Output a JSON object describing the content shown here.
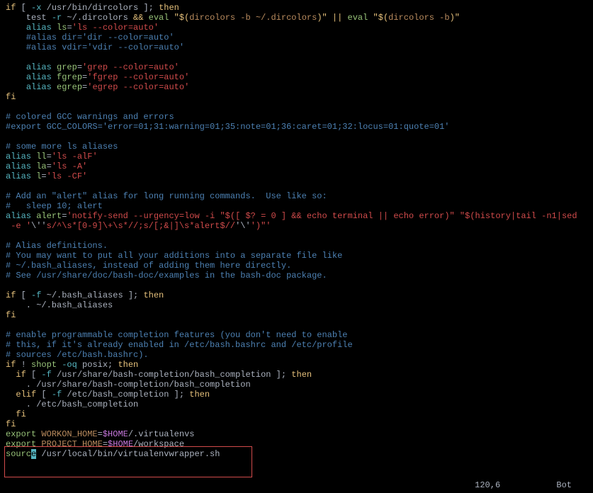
{
  "lines": [
    [
      {
        "t": "if",
        "c": "c-yellow"
      },
      {
        "t": " [ ",
        "c": "c-white"
      },
      {
        "t": "-x",
        "c": "c-cyan"
      },
      {
        "t": " /usr/bin/dircolors ]; ",
        "c": "c-white"
      },
      {
        "t": "then",
        "c": "c-yellow"
      }
    ],
    [
      {
        "t": "    test ",
        "c": "c-white"
      },
      {
        "t": "-r",
        "c": "c-cyan"
      },
      {
        "t": " ~/.dircolors ",
        "c": "c-white"
      },
      {
        "t": "&&",
        "c": "c-yellow"
      },
      {
        "t": " ",
        "c": "c-white"
      },
      {
        "t": "eval",
        "c": "c-green"
      },
      {
        "t": " \"",
        "c": "c-yellow"
      },
      {
        "t": "$(",
        "c": "c-yellow"
      },
      {
        "t": "dircolors -b ~/.dircolors",
        "c": "c-brown"
      },
      {
        "t": ")",
        "c": "c-yellow"
      },
      {
        "t": "\" ",
        "c": "c-yellow"
      },
      {
        "t": "||",
        "c": "c-yellow"
      },
      {
        "t": " ",
        "c": "c-white"
      },
      {
        "t": "eval",
        "c": "c-green"
      },
      {
        "t": " \"",
        "c": "c-yellow"
      },
      {
        "t": "$(",
        "c": "c-yellow"
      },
      {
        "t": "dircolors -b",
        "c": "c-brown"
      },
      {
        "t": ")",
        "c": "c-yellow"
      },
      {
        "t": "\"",
        "c": "c-yellow"
      }
    ],
    [
      {
        "t": "    ",
        "c": "c-white"
      },
      {
        "t": "alias",
        "c": "c-cyan"
      },
      {
        "t": " ",
        "c": "c-white"
      },
      {
        "t": "ls",
        "c": "c-green"
      },
      {
        "t": "=",
        "c": "c-white"
      },
      {
        "t": "'ls --color=auto'",
        "c": "c-red"
      }
    ],
    [
      {
        "t": "    #alias dir='dir --color=auto'",
        "c": "c-blue"
      }
    ],
    [
      {
        "t": "    #alias vdir='vdir --color=auto'",
        "c": "c-blue"
      }
    ],
    [
      {
        "t": "",
        "c": ""
      }
    ],
    [
      {
        "t": "    ",
        "c": "c-white"
      },
      {
        "t": "alias",
        "c": "c-cyan"
      },
      {
        "t": " ",
        "c": "c-white"
      },
      {
        "t": "grep",
        "c": "c-green"
      },
      {
        "t": "=",
        "c": "c-white"
      },
      {
        "t": "'grep --color=auto'",
        "c": "c-red"
      }
    ],
    [
      {
        "t": "    ",
        "c": "c-white"
      },
      {
        "t": "alias",
        "c": "c-cyan"
      },
      {
        "t": " ",
        "c": "c-white"
      },
      {
        "t": "fgrep",
        "c": "c-green"
      },
      {
        "t": "=",
        "c": "c-white"
      },
      {
        "t": "'fgrep --color=auto'",
        "c": "c-red"
      }
    ],
    [
      {
        "t": "    ",
        "c": "c-white"
      },
      {
        "t": "alias",
        "c": "c-cyan"
      },
      {
        "t": " ",
        "c": "c-white"
      },
      {
        "t": "egrep",
        "c": "c-green"
      },
      {
        "t": "=",
        "c": "c-white"
      },
      {
        "t": "'egrep --color=auto'",
        "c": "c-red"
      }
    ],
    [
      {
        "t": "fi",
        "c": "c-yellow"
      }
    ],
    [
      {
        "t": "",
        "c": ""
      }
    ],
    [
      {
        "t": "# colored GCC warnings and errors",
        "c": "c-blue"
      }
    ],
    [
      {
        "t": "#export GCC_COLORS='error=01;31:warning=01;35:note=01;36:caret=01;32:locus=01:quote=01'",
        "c": "c-blue"
      }
    ],
    [
      {
        "t": "",
        "c": ""
      }
    ],
    [
      {
        "t": "# some more ls aliases",
        "c": "c-blue"
      }
    ],
    [
      {
        "t": "alias",
        "c": "c-cyan"
      },
      {
        "t": " ",
        "c": "c-white"
      },
      {
        "t": "ll",
        "c": "c-green"
      },
      {
        "t": "=",
        "c": "c-white"
      },
      {
        "t": "'ls -alF'",
        "c": "c-red"
      }
    ],
    [
      {
        "t": "alias",
        "c": "c-cyan"
      },
      {
        "t": " ",
        "c": "c-white"
      },
      {
        "t": "la",
        "c": "c-green"
      },
      {
        "t": "=",
        "c": "c-white"
      },
      {
        "t": "'ls -A'",
        "c": "c-red"
      }
    ],
    [
      {
        "t": "alias",
        "c": "c-cyan"
      },
      {
        "t": " ",
        "c": "c-white"
      },
      {
        "t": "l",
        "c": "c-green"
      },
      {
        "t": "=",
        "c": "c-white"
      },
      {
        "t": "'ls -CF'",
        "c": "c-red"
      }
    ],
    [
      {
        "t": "",
        "c": ""
      }
    ],
    [
      {
        "t": "# Add an \"alert\" alias for long running commands.  Use like so:",
        "c": "c-blue"
      }
    ],
    [
      {
        "t": "#   sleep 10; alert",
        "c": "c-blue"
      }
    ],
    [
      {
        "t": "alias",
        "c": "c-cyan"
      },
      {
        "t": " ",
        "c": "c-white"
      },
      {
        "t": "alert",
        "c": "c-green"
      },
      {
        "t": "=",
        "c": "c-white"
      },
      {
        "t": "'notify-send --urgency=low -i \"$([ $? = 0 ] && echo terminal || echo error)\" \"$(history|tail -n1|sed",
        "c": "c-red"
      }
    ],
    [
      {
        "t": " -e ",
        "c": "c-red"
      },
      {
        "t": "'",
        "c": "c-red"
      },
      {
        "t": "\\''",
        "c": "c-white"
      },
      {
        "t": "s/^\\s*[0-9]\\+\\s*//;s/[;&|]\\s*alert$//",
        "c": "c-red"
      },
      {
        "t": "'\\'",
        "c": "c-white"
      },
      {
        "t": "')\"'",
        "c": "c-red"
      }
    ],
    [
      {
        "t": "",
        "c": ""
      }
    ],
    [
      {
        "t": "# Alias definitions.",
        "c": "c-blue"
      }
    ],
    [
      {
        "t": "# You may want to put all your additions into a separate file like",
        "c": "c-blue"
      }
    ],
    [
      {
        "t": "# ~/.bash_aliases, instead of adding them here directly.",
        "c": "c-blue"
      }
    ],
    [
      {
        "t": "# See /usr/share/doc/bash-doc/examples in the bash-doc package.",
        "c": "c-blue"
      }
    ],
    [
      {
        "t": "",
        "c": ""
      }
    ],
    [
      {
        "t": "if",
        "c": "c-yellow"
      },
      {
        "t": " [ ",
        "c": "c-white"
      },
      {
        "t": "-f",
        "c": "c-cyan"
      },
      {
        "t": " ~/.bash_aliases ]; ",
        "c": "c-white"
      },
      {
        "t": "then",
        "c": "c-yellow"
      }
    ],
    [
      {
        "t": "    . ~/.bash_aliases",
        "c": "c-white"
      }
    ],
    [
      {
        "t": "fi",
        "c": "c-yellow"
      }
    ],
    [
      {
        "t": "",
        "c": ""
      }
    ],
    [
      {
        "t": "# enable programmable completion features (you don't need to enable",
        "c": "c-blue"
      }
    ],
    [
      {
        "t": "# this, if it's already enabled in /etc/bash.bashrc and /etc/profile",
        "c": "c-blue"
      }
    ],
    [
      {
        "t": "# sources /etc/bash.bashrc).",
        "c": "c-blue"
      }
    ],
    [
      {
        "t": "if",
        "c": "c-yellow"
      },
      {
        "t": " ! ",
        "c": "c-white"
      },
      {
        "t": "shopt",
        "c": "c-green"
      },
      {
        "t": " ",
        "c": "c-white"
      },
      {
        "t": "-oq",
        "c": "c-cyan"
      },
      {
        "t": " posix; ",
        "c": "c-white"
      },
      {
        "t": "then",
        "c": "c-yellow"
      }
    ],
    [
      {
        "t": "  ",
        "c": "c-white"
      },
      {
        "t": "if",
        "c": "c-yellow"
      },
      {
        "t": " [ ",
        "c": "c-white"
      },
      {
        "t": "-f",
        "c": "c-cyan"
      },
      {
        "t": " /usr/share/bash-completion/bash_completion ]; ",
        "c": "c-white"
      },
      {
        "t": "then",
        "c": "c-yellow"
      }
    ],
    [
      {
        "t": "    . /usr/share/bash-completion/bash_completion",
        "c": "c-white"
      }
    ],
    [
      {
        "t": "  ",
        "c": "c-white"
      },
      {
        "t": "elif",
        "c": "c-yellow"
      },
      {
        "t": " [ ",
        "c": "c-white"
      },
      {
        "t": "-f",
        "c": "c-cyan"
      },
      {
        "t": " /etc/bash_completion ]; ",
        "c": "c-white"
      },
      {
        "t": "then",
        "c": "c-yellow"
      }
    ],
    [
      {
        "t": "    . /etc/bash_completion",
        "c": "c-white"
      }
    ],
    [
      {
        "t": "  ",
        "c": "c-white"
      },
      {
        "t": "fi",
        "c": "c-yellow"
      }
    ],
    [
      {
        "t": "fi",
        "c": "c-yellow"
      }
    ],
    [
      {
        "t": "export",
        "c": "c-green"
      },
      {
        "t": " ",
        "c": "c-white"
      },
      {
        "t": "WORKON_HOME",
        "c": "c-brown"
      },
      {
        "t": "=",
        "c": "c-white"
      },
      {
        "t": "$HOME",
        "c": "c-purple"
      },
      {
        "t": "/.virtualenvs",
        "c": "c-white"
      }
    ],
    [
      {
        "t": "export",
        "c": "c-green"
      },
      {
        "t": " ",
        "c": "c-white"
      },
      {
        "t": "PROJECT_HOME",
        "c": "c-brown"
      },
      {
        "t": "=",
        "c": "c-white"
      },
      {
        "t": "$HOME",
        "c": "c-purple"
      },
      {
        "t": "/workspace",
        "c": "c-white"
      }
    ],
    [
      {
        "t": "sourc",
        "c": "c-green"
      },
      {
        "t": "e",
        "c": "cursor"
      },
      {
        "t": " /usr/local/bin/virtualenvwrapper.sh",
        "c": "c-white"
      }
    ]
  ],
  "status": {
    "position": "120,6",
    "scroll": "Bot"
  }
}
